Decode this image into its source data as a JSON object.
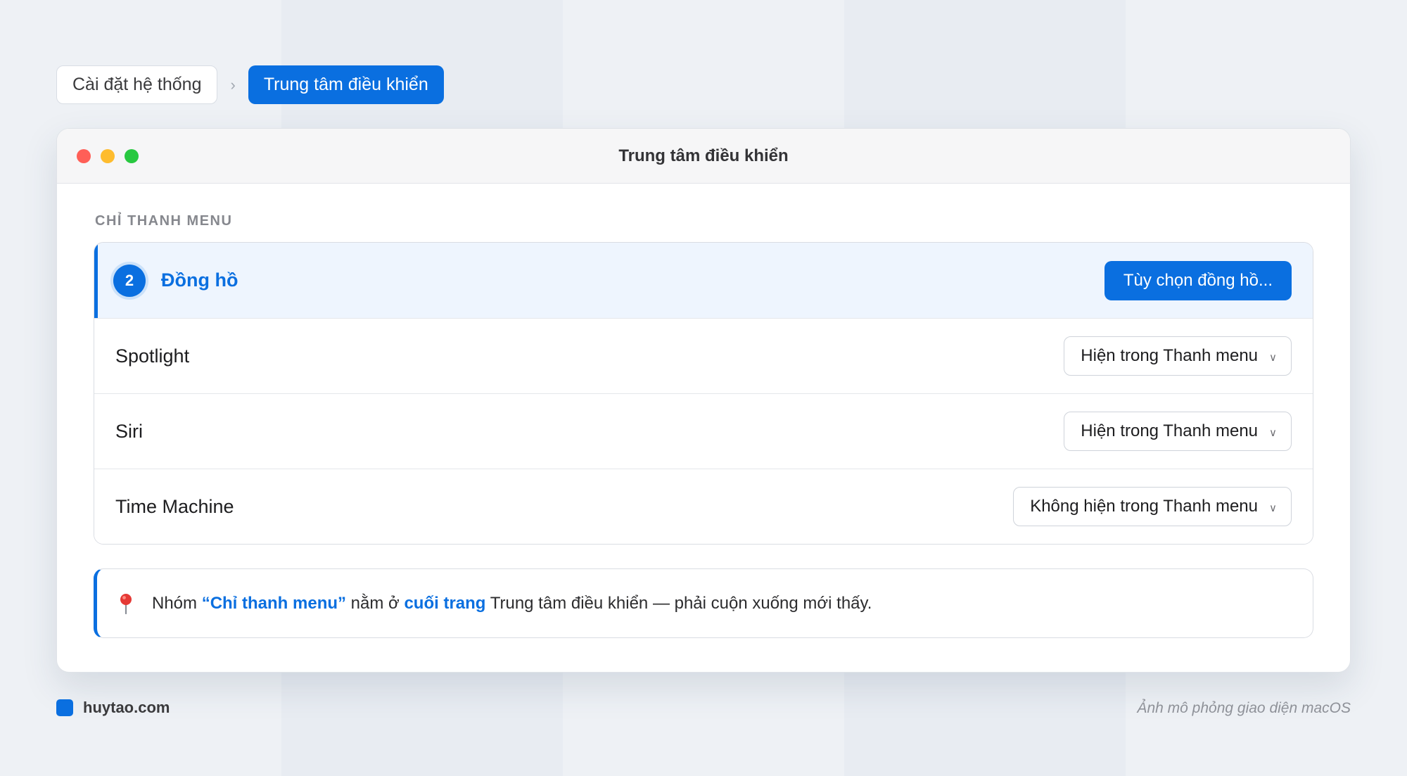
{
  "breadcrumb": {
    "items": [
      {
        "label": "Cài đặt hệ thống",
        "active": false
      },
      {
        "label": "Trung tâm điều khiển",
        "active": true
      }
    ],
    "separator": "›"
  },
  "window": {
    "title": "Trung tâm điều khiển",
    "section_label": "CHỈ THANH MENU",
    "rows": [
      {
        "label": "Đồng hồ",
        "badge": "2",
        "highlighted": true,
        "control": "button",
        "button_label": "Tùy chọn đồng hồ..."
      },
      {
        "label": "Spotlight",
        "control": "select",
        "value": "Hiện trong Thanh menu"
      },
      {
        "label": "Siri",
        "control": "select",
        "value": "Hiện trong Thanh menu"
      },
      {
        "label": "Time Machine",
        "control": "select",
        "value": "Không hiện trong Thanh menu"
      }
    ],
    "note": {
      "icon": "pin-icon",
      "prefix": "Nhóm ",
      "highlight_1": "“Chỉ thanh menu”",
      "middle": " nằm ở ",
      "highlight_2": "cuối trang",
      "suffix": " Trung tâm điều khiển — phải cuộn xuống mới thấy."
    }
  },
  "footer": {
    "brand": "huytao.com",
    "caption": "Ảnh mô phỏng giao diện macOS"
  },
  "colors": {
    "accent": "#0a6fe0",
    "traffic_red": "#ff5f57",
    "traffic_yellow": "#febc2e",
    "traffic_green": "#28c840"
  }
}
